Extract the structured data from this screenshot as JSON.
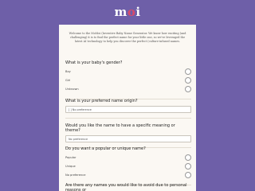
{
  "brand": {
    "logo_prefix": "m",
    "logo_accent": "o",
    "logo_suffix": "i"
  },
  "intro": {
    "text": "Welcome to the MoMoi (Inventive Baby Name Generator. We know how exciting (and challenging) it is to find the perfect name for your little one, so we've leveraged the latest AI technology to help you discover the perfect (culture-infused names."
  },
  "questions": {
    "gender": {
      "label": "What is your baby's gender?",
      "options": [
        "Boy",
        "Girl",
        "Unknown"
      ]
    },
    "origin": {
      "label": "What is your preferred name origin?",
      "selected": "[ ] No preference"
    },
    "meaning": {
      "label": "Would you like the name to have a specific meaning or theme?",
      "selected": "No preference"
    },
    "popularity": {
      "label": "Do you want a popular or unique name?",
      "options": [
        "Popular",
        "Unique",
        "No preference"
      ]
    },
    "avoid": {
      "label": "Are there any names you would like to avoid due to personal reasons or"
    }
  },
  "colors": {
    "background": "#6e5fa8",
    "card": "#fbf8f3",
    "logo_accent": "#d94a6b"
  }
}
